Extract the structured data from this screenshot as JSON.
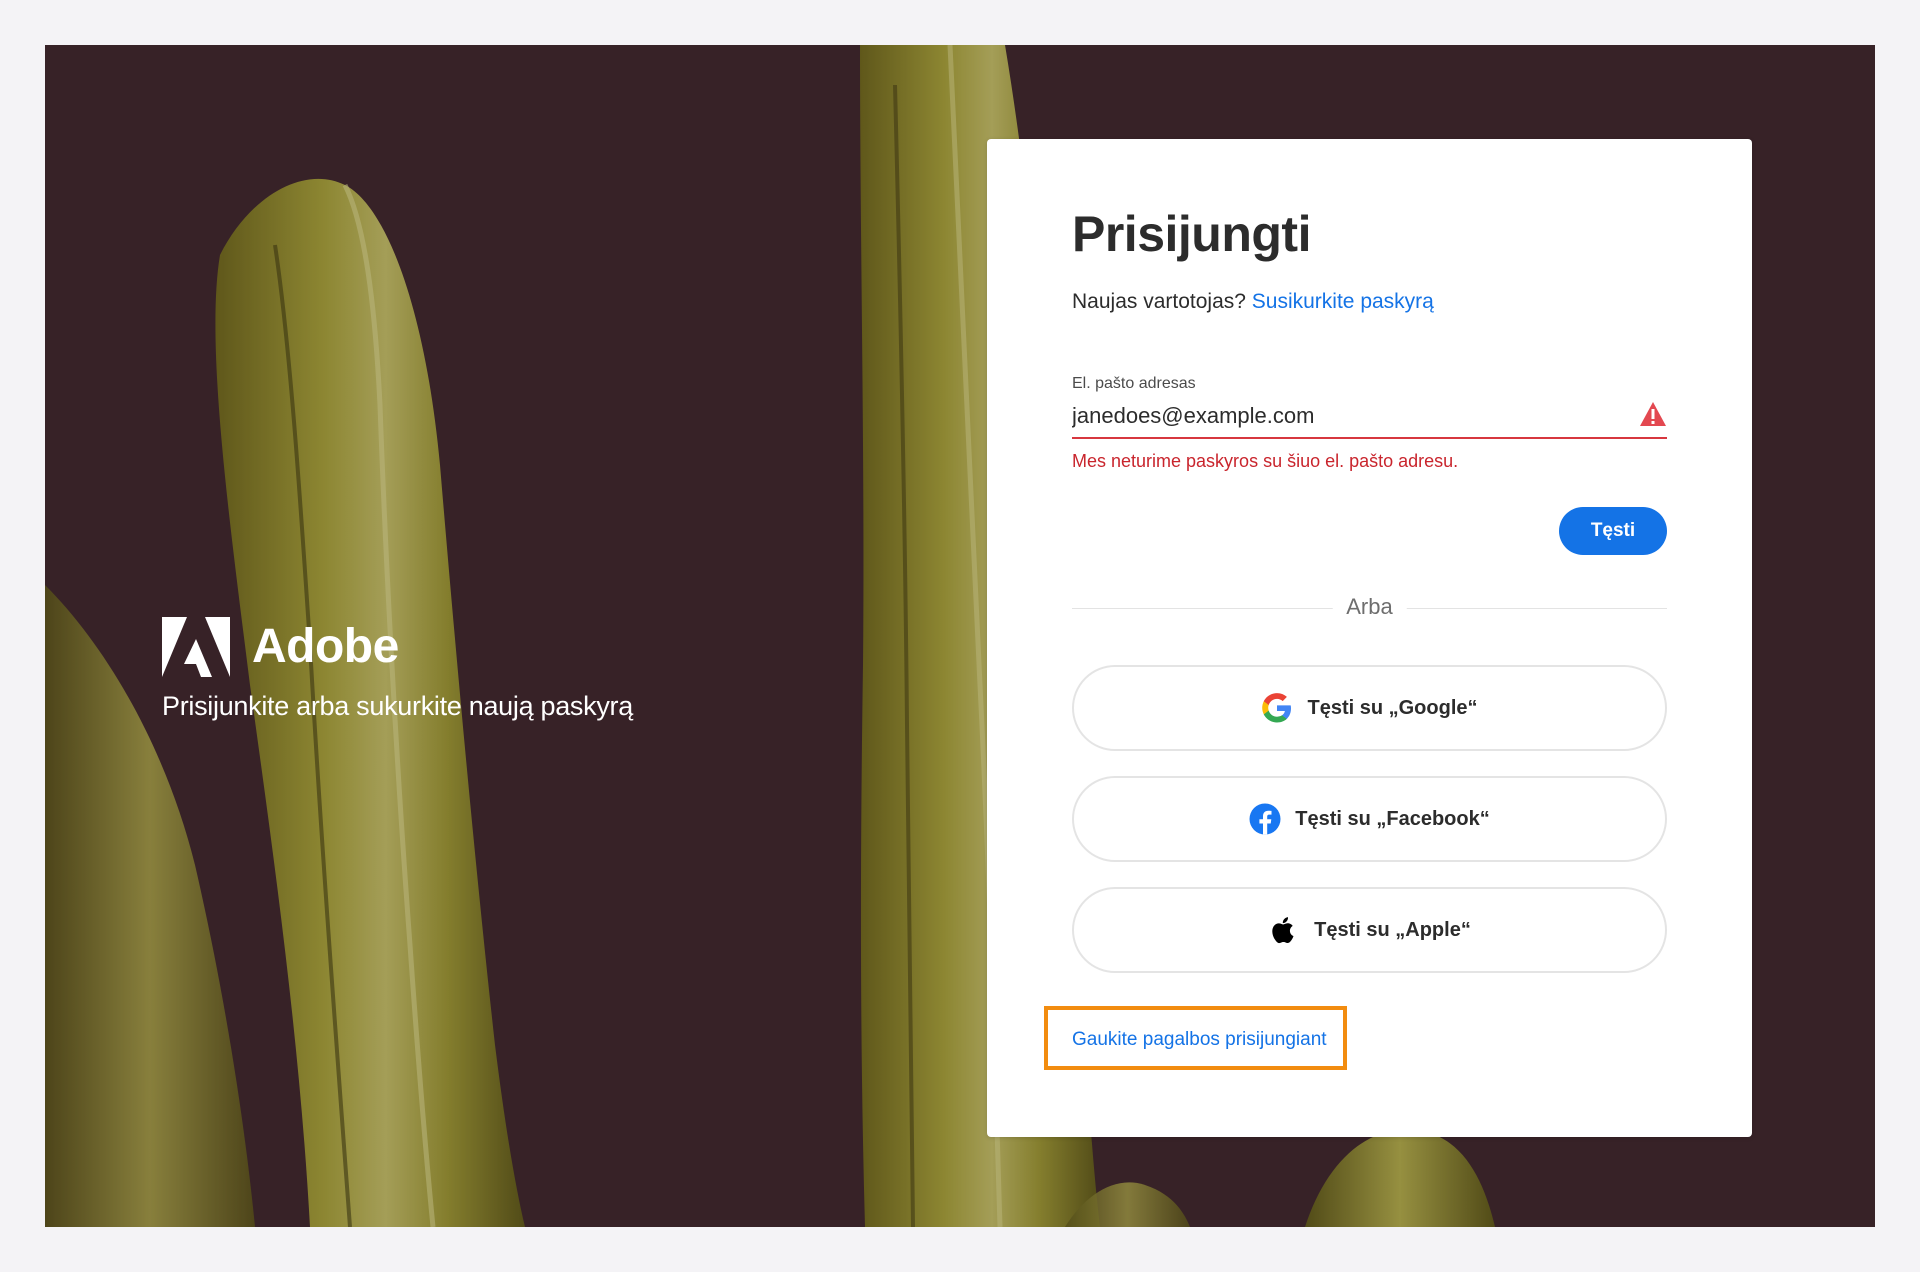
{
  "brand": {
    "name": "Adobe",
    "tagline": "Prisijunkite arba sukurkite naują paskyrą"
  },
  "signin": {
    "title": "Prisijungti",
    "new_user_prompt": "Naujas vartotojas?",
    "create_account_link": "Susikurkite paskyrą",
    "email_label": "El. pašto adresas",
    "email_value": "janedoes@example.com",
    "error_message": "Mes neturime paskyros su šiuo el. pašto adresu.",
    "continue_button": "Tęsti",
    "divider_text": "Arba",
    "google_button": "Tęsti su „Google“",
    "facebook_button": "Tęsti su „Facebook“",
    "apple_button": "Tęsti su „Apple“",
    "help_link": "Gaukite pagalbos prisijungiant"
  },
  "colors": {
    "accent": "#1473e6",
    "error": "#d7373f",
    "highlight": "#f28c0f",
    "background": "#3c262c"
  },
  "icons": {
    "alert": "alert-triangle-icon",
    "google": "google-logo-icon",
    "facebook": "facebook-logo-icon",
    "apple": "apple-logo-icon",
    "brand": "adobe-logo-icon"
  }
}
